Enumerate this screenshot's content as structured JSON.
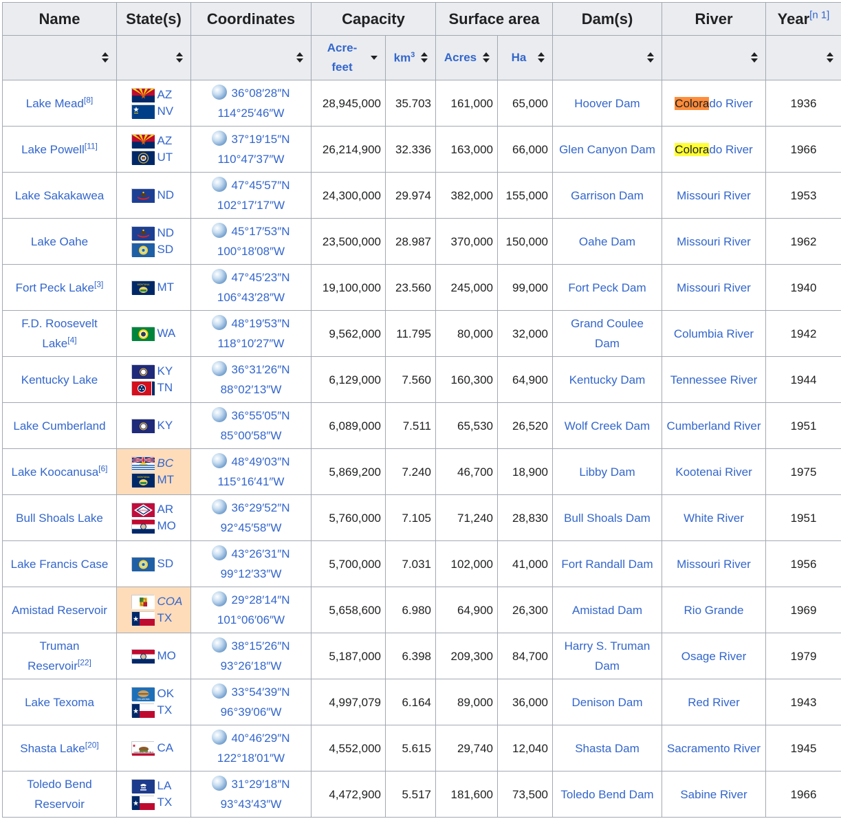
{
  "colors": {
    "link": "#3366cc",
    "header_bg": "#eaecf0",
    "border": "#a2a9b1",
    "province_bg": "#fedcba",
    "highlight_orange": "#ff8c3a",
    "highlight_yellow": "#ffff33"
  },
  "header": {
    "name": "Name",
    "states": "State(s)",
    "coordinates": "Coordinates",
    "capacity": "Capacity",
    "surface_area": "Surface area",
    "dams": "Dam(s)",
    "river": "River",
    "year": "Year",
    "year_note": "[n 1]",
    "sub": {
      "acre_feet": "Acre-feet",
      "km3": "km",
      "km3_sup": "3",
      "acres": "Acres",
      "ha": "Ha"
    }
  },
  "rows": [
    {
      "name": "Lake Mead",
      "ref": "[8]",
      "states": [
        {
          "code": "AZ",
          "flag": "AZ"
        },
        {
          "code": "NV",
          "flag": "NV"
        }
      ],
      "lat": "36°08′28″N",
      "lon": "114°25′46″W",
      "acre_feet": "28,945,000",
      "km3": "35.703",
      "acres": "161,000",
      "ha": "65,000",
      "dam": "Hoover Dam",
      "river": "Colorado River",
      "river_hl": "Colora",
      "river_rest": "do River",
      "hl": "orange",
      "year": "1936"
    },
    {
      "name": "Lake Powell",
      "ref": "[11]",
      "states": [
        {
          "code": "AZ",
          "flag": "AZ"
        },
        {
          "code": "UT",
          "flag": "UT"
        }
      ],
      "lat": "37°19′15″N",
      "lon": "110°47′37″W",
      "acre_feet": "26,214,900",
      "km3": "32.336",
      "acres": "163,000",
      "ha": "66,000",
      "dam": "Glen Canyon Dam",
      "river": "Colorado River",
      "river_hl": "Colora",
      "river_rest": "do River",
      "hl": "yellow",
      "year": "1966"
    },
    {
      "name": "Lake Sakakawea",
      "ref": "",
      "states": [
        {
          "code": "ND",
          "flag": "ND"
        }
      ],
      "lat": "47°45′57″N",
      "lon": "102°17′17″W",
      "acre_feet": "24,300,000",
      "km3": "29.974",
      "acres": "382,000",
      "ha": "155,000",
      "dam": "Garrison Dam",
      "river": "Missouri River",
      "year": "1953"
    },
    {
      "name": "Lake Oahe",
      "ref": "",
      "states": [
        {
          "code": "ND",
          "flag": "ND"
        },
        {
          "code": "SD",
          "flag": "SD"
        }
      ],
      "lat": "45°17′53″N",
      "lon": "100°18′08″W",
      "acre_feet": "23,500,000",
      "km3": "28.987",
      "acres": "370,000",
      "ha": "150,000",
      "dam": "Oahe Dam",
      "river": "Missouri River",
      "year": "1962"
    },
    {
      "name": "Fort Peck Lake",
      "ref": "[3]",
      "states": [
        {
          "code": "MT",
          "flag": "MT"
        }
      ],
      "lat": "47°45′23″N",
      "lon": "106°43′28″W",
      "acre_feet": "19,100,000",
      "km3": "23.560",
      "acres": "245,000",
      "ha": "99,000",
      "dam": "Fort Peck Dam",
      "river": "Missouri River",
      "year": "1940"
    },
    {
      "name": "F.D. Roosevelt Lake",
      "ref": "[4]",
      "states": [
        {
          "code": "WA",
          "flag": "WA"
        }
      ],
      "lat": "48°19′53″N",
      "lon": "118°10′27″W",
      "acre_feet": "9,562,000",
      "km3": "11.795",
      "acres": "80,000",
      "ha": "32,000",
      "dam": "Grand Coulee Dam",
      "river": "Columbia River",
      "year": "1942"
    },
    {
      "name": "Kentucky Lake",
      "ref": "",
      "states": [
        {
          "code": "KY",
          "flag": "KY"
        },
        {
          "code": "TN",
          "flag": "TN"
        }
      ],
      "lat": "36°31′26″N",
      "lon": "88°02′13″W",
      "acre_feet": "6,129,000",
      "km3": "7.560",
      "acres": "160,300",
      "ha": "64,900",
      "dam": "Kentucky Dam",
      "river": "Tennessee River",
      "year": "1944"
    },
    {
      "name": "Lake Cumberland",
      "ref": "",
      "states": [
        {
          "code": "KY",
          "flag": "KY"
        }
      ],
      "lat": "36°55′05″N",
      "lon": "85°00′58″W",
      "acre_feet": "6,089,000",
      "km3": "7.511",
      "acres": "65,530",
      "ha": "26,520",
      "dam": "Wolf Creek Dam",
      "river": "Cumberland River",
      "year": "1951"
    },
    {
      "name": "Lake Koocanusa",
      "ref": "[6]",
      "prov": true,
      "states": [
        {
          "code": "BC",
          "flag": "BC",
          "it": true
        },
        {
          "code": "MT",
          "flag": "MT"
        }
      ],
      "lat": "48°49′03″N",
      "lon": "115°16′41″W",
      "acre_feet": "5,869,200",
      "km3": "7.240",
      "acres": "46,700",
      "ha": "18,900",
      "dam": "Libby Dam",
      "river": "Kootenai River",
      "year": "1975"
    },
    {
      "name": "Bull Shoals Lake",
      "ref": "",
      "states": [
        {
          "code": "AR",
          "flag": "AR"
        },
        {
          "code": "MO",
          "flag": "MO"
        }
      ],
      "lat": "36°29′52″N",
      "lon": "92°45′58″W",
      "acre_feet": "5,760,000",
      "km3": "7.105",
      "acres": "71,240",
      "ha": "28,830",
      "dam": "Bull Shoals Dam",
      "river": "White River",
      "year": "1951"
    },
    {
      "name": "Lake Francis Case",
      "ref": "",
      "states": [
        {
          "code": "SD",
          "flag": "SD"
        }
      ],
      "lat": "43°26′31″N",
      "lon": "99°12′33″W",
      "acre_feet": "5,700,000",
      "km3": "7.031",
      "acres": "102,000",
      "ha": "41,000",
      "dam": "Fort Randall Dam",
      "river": "Missouri River",
      "year": "1956"
    },
    {
      "name": "Amistad Reservoir",
      "ref": "",
      "prov": true,
      "states": [
        {
          "code": "COA",
          "flag": "COA",
          "it": true
        },
        {
          "code": "TX",
          "flag": "TX"
        }
      ],
      "lat": "29°28′14″N",
      "lon": "101°06′06″W",
      "acre_feet": "5,658,600",
      "km3": "6.980",
      "acres": "64,900",
      "ha": "26,300",
      "dam": "Amistad Dam",
      "river": "Rio Grande",
      "year": "1969"
    },
    {
      "name": "Truman Reservoir",
      "ref": "[22]",
      "states": [
        {
          "code": "MO",
          "flag": "MO"
        }
      ],
      "lat": "38°15′26″N",
      "lon": "93°26′18″W",
      "acre_feet": "5,187,000",
      "km3": "6.398",
      "acres": "209,300",
      "ha": "84,700",
      "dam": "Harry S. Truman Dam",
      "river": "Osage River",
      "year": "1979"
    },
    {
      "name": "Lake Texoma",
      "ref": "",
      "states": [
        {
          "code": "OK",
          "flag": "OK"
        },
        {
          "code": "TX",
          "flag": "TX"
        }
      ],
      "lat": "33°54′39″N",
      "lon": "96°39′06″W",
      "acre_feet": "4,997,079",
      "km3": "6.164",
      "acres": "89,000",
      "ha": "36,000",
      "dam": "Denison Dam",
      "river": "Red River",
      "year": "1943"
    },
    {
      "name": "Shasta Lake",
      "ref": "[20]",
      "states": [
        {
          "code": "CA",
          "flag": "CA"
        }
      ],
      "lat": "40°46′29″N",
      "lon": "122°18′01″W",
      "acre_feet": "4,552,000",
      "km3": "5.615",
      "acres": "29,740",
      "ha": "12,040",
      "dam": "Shasta Dam",
      "river": "Sacramento River",
      "year": "1945"
    },
    {
      "name": "Toledo Bend Reservoir",
      "ref": "",
      "states": [
        {
          "code": "LA",
          "flag": "LA"
        },
        {
          "code": "TX",
          "flag": "TX"
        }
      ],
      "lat": "31°29′18″N",
      "lon": "93°43′43″W",
      "acre_feet": "4,472,900",
      "km3": "5.517",
      "acres": "181,600",
      "ha": "73,500",
      "dam": "Toledo Bend Dam",
      "river": "Sabine River",
      "year": "1966"
    }
  ]
}
